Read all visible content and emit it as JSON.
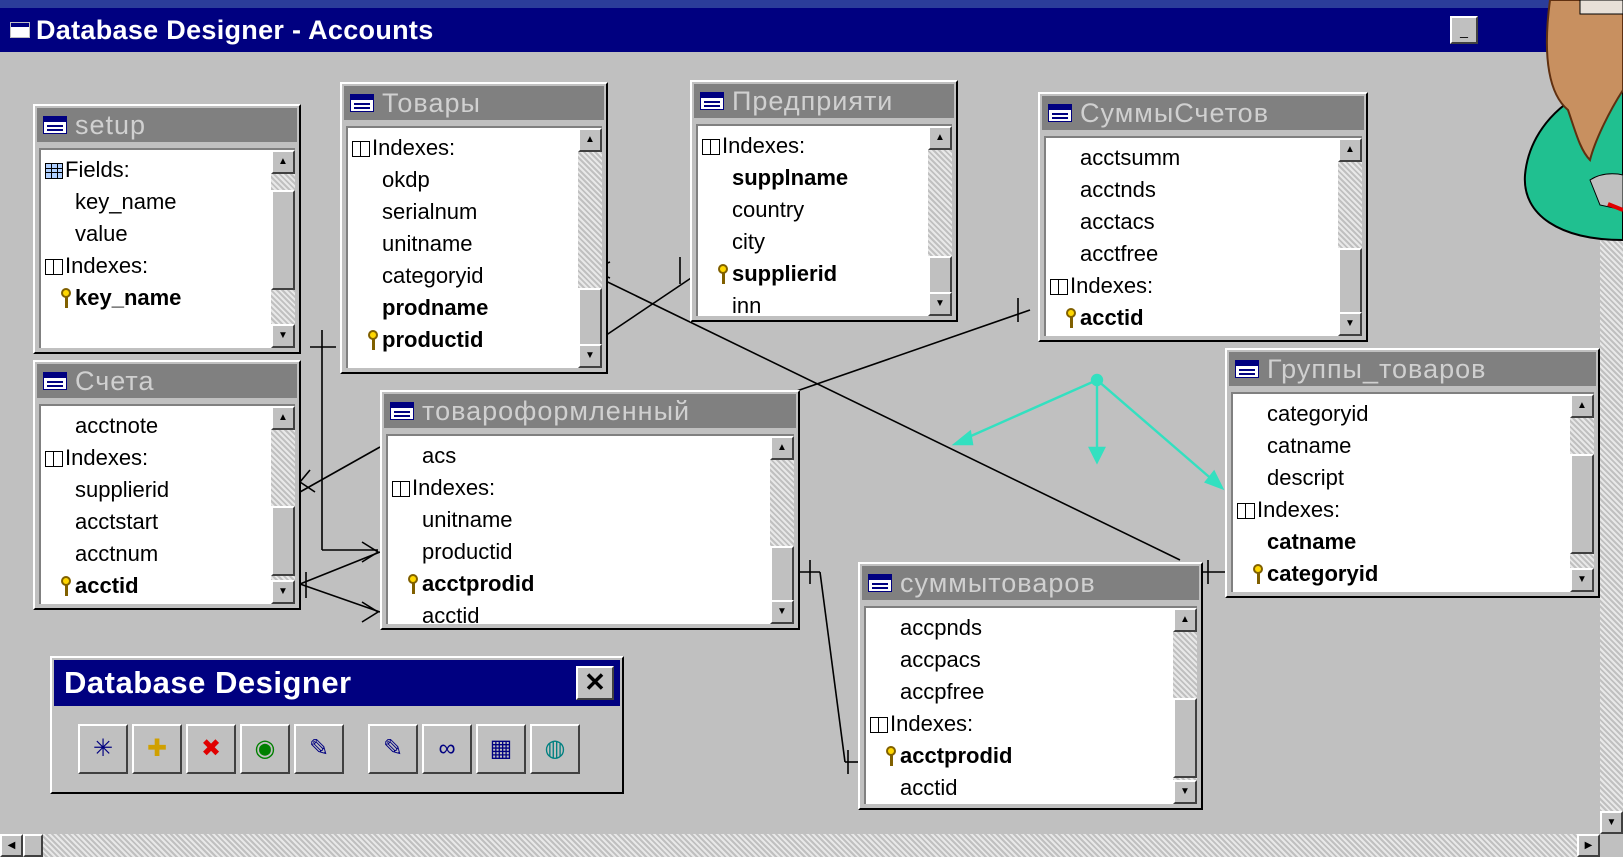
{
  "window": {
    "title": "Database Designer - Accounts"
  },
  "tables": [
    {
      "name": "setup",
      "rows": [
        {
          "text": "Fields:",
          "kind": "section-fields"
        },
        {
          "text": "key_name",
          "kind": "field"
        },
        {
          "text": "value",
          "kind": "field"
        },
        {
          "text": "Indexes:",
          "kind": "section-indexes"
        },
        {
          "text": "key_name",
          "kind": "key"
        }
      ]
    },
    {
      "name": "Товары",
      "rows": [
        {
          "text": "Indexes:",
          "kind": "section-indexes"
        },
        {
          "text": "okdp",
          "kind": "field"
        },
        {
          "text": "serialnum",
          "kind": "field"
        },
        {
          "text": "unitname",
          "kind": "field"
        },
        {
          "text": "categoryid",
          "kind": "field"
        },
        {
          "text": "prodname",
          "kind": "bold"
        },
        {
          "text": "productid",
          "kind": "key"
        }
      ]
    },
    {
      "name": "Предприяти",
      "rows": [
        {
          "text": "Indexes:",
          "kind": "section-indexes"
        },
        {
          "text": "supplname",
          "kind": "bold"
        },
        {
          "text": "country",
          "kind": "field"
        },
        {
          "text": "city",
          "kind": "field"
        },
        {
          "text": "supplierid",
          "kind": "key"
        },
        {
          "text": "inn",
          "kind": "field"
        }
      ]
    },
    {
      "name": "СуммыСчетов",
      "rows": [
        {
          "text": "acctsumm",
          "kind": "field"
        },
        {
          "text": "acctnds",
          "kind": "field"
        },
        {
          "text": "acctacs",
          "kind": "field"
        },
        {
          "text": "acctfree",
          "kind": "field"
        },
        {
          "text": "Indexes:",
          "kind": "section-indexes"
        },
        {
          "text": "acctid",
          "kind": "key"
        }
      ]
    },
    {
      "name": "Счета",
      "rows": [
        {
          "text": "acctnote",
          "kind": "field"
        },
        {
          "text": "Indexes:",
          "kind": "section-indexes"
        },
        {
          "text": "supplierid",
          "kind": "field"
        },
        {
          "text": "acctstart",
          "kind": "field"
        },
        {
          "text": "acctnum",
          "kind": "field"
        },
        {
          "text": "acctid",
          "kind": "key"
        }
      ]
    },
    {
      "name": "товароформленный",
      "rows": [
        {
          "text": "acs",
          "kind": "field"
        },
        {
          "text": "Indexes:",
          "kind": "section-indexes"
        },
        {
          "text": "unitname",
          "kind": "field"
        },
        {
          "text": "productid",
          "kind": "field"
        },
        {
          "text": "acctprodid",
          "kind": "key"
        },
        {
          "text": "acctid",
          "kind": "field"
        }
      ]
    },
    {
      "name": "Группы_товаров",
      "rows": [
        {
          "text": "categoryid",
          "kind": "field"
        },
        {
          "text": "catname",
          "kind": "field"
        },
        {
          "text": "descript",
          "kind": "field"
        },
        {
          "text": "Indexes:",
          "kind": "section-indexes"
        },
        {
          "text": "catname",
          "kind": "bold"
        },
        {
          "text": "categoryid",
          "kind": "key"
        }
      ]
    },
    {
      "name": "суммытоваров",
      "rows": [
        {
          "text": "accpnds",
          "kind": "field"
        },
        {
          "text": "accpacs",
          "kind": "field"
        },
        {
          "text": "accpfree",
          "kind": "field"
        },
        {
          "text": "Indexes:",
          "kind": "section-indexes"
        },
        {
          "text": "acctprodid",
          "kind": "key"
        },
        {
          "text": "acctid",
          "kind": "field"
        }
      ]
    }
  ],
  "toolbar": {
    "title": "Database Designer",
    "close_label": "✕",
    "buttons": [
      {
        "name": "new-table-button",
        "icon": "new-table-icon",
        "glyph": "✳"
      },
      {
        "name": "add-table-button",
        "icon": "add-table-icon",
        "glyph": "✚"
      },
      {
        "name": "remove-table-button",
        "icon": "remove-table-icon",
        "glyph": "✖"
      },
      {
        "name": "add-remote-view-button",
        "icon": "remote-view-icon",
        "glyph": "◉"
      },
      {
        "name": "modify-table-button",
        "icon": "modify-table-icon",
        "glyph": "✎"
      },
      {
        "name": "browse-table-button",
        "icon": "browse-table-icon",
        "glyph": "✎"
      },
      {
        "name": "edit-stored-procedure-button",
        "icon": "glasses-icon",
        "glyph": "∞"
      },
      {
        "name": "connections-button",
        "icon": "grid-icon",
        "glyph": "▦"
      },
      {
        "name": "edit-connections-button",
        "icon": "globe-icon",
        "glyph": "◍"
      }
    ]
  },
  "colors": {
    "titlebar": "#000080",
    "desktop": "#2b3d9a",
    "window_bg": "#c0c0c0",
    "table_header_inactive": "#808080",
    "relation_line": "#000000",
    "arrow": "#33e0c0"
  },
  "icons": {
    "title_icon": "database-window-icon",
    "table_icon": "table-grid-icon",
    "fields_icon": "fields-icon",
    "indexes_icon": "index-book-icon",
    "key_icon": "primary-key-icon",
    "assistant": "office-assistant-hand"
  }
}
